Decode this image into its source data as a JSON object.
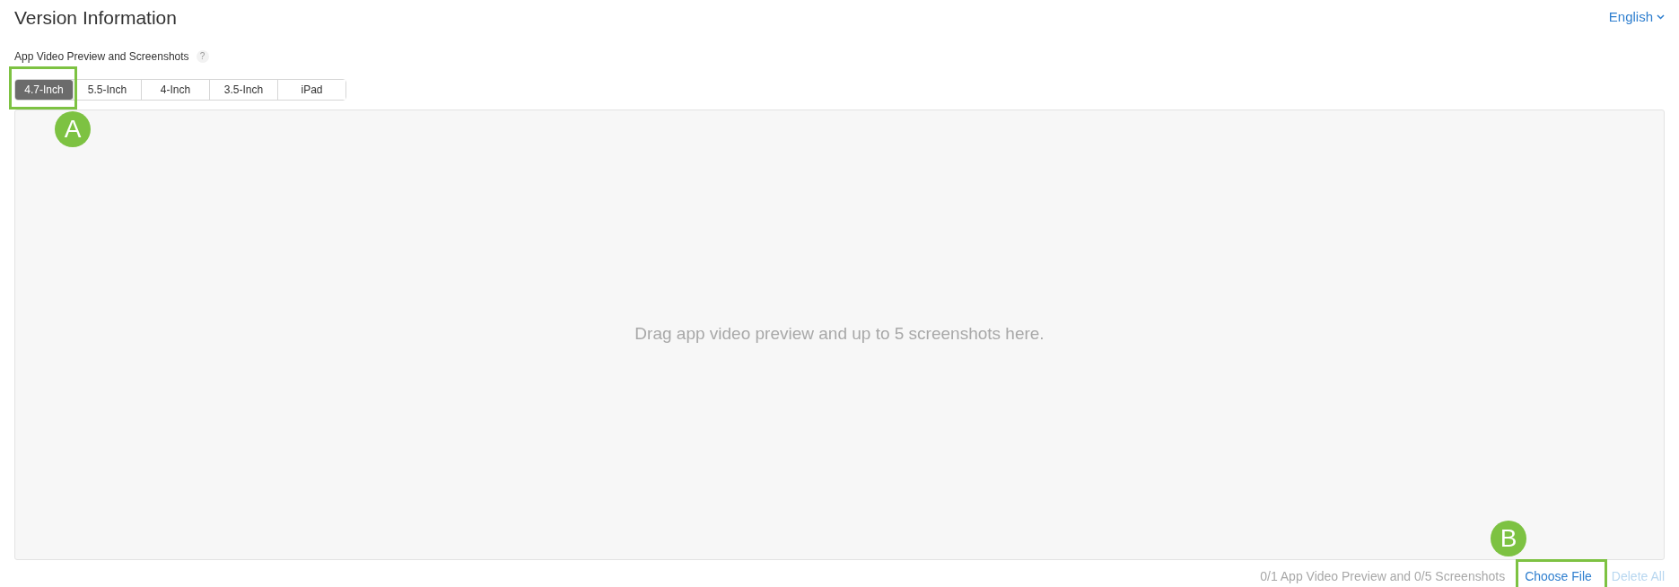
{
  "title": "Version Information",
  "language": {
    "label": "English"
  },
  "section": {
    "label": "App Video Preview and Screenshots",
    "help": "?"
  },
  "tabs": [
    {
      "label": "4.7-Inch",
      "selected": true
    },
    {
      "label": "5.5-Inch",
      "selected": false
    },
    {
      "label": "4-Inch",
      "selected": false
    },
    {
      "label": "3.5-Inch",
      "selected": false
    },
    {
      "label": "iPad",
      "selected": false
    }
  ],
  "drop_zone": {
    "message": "Drag app video preview and up to 5 screenshots here."
  },
  "footer": {
    "count": "0/1 App Video Preview and 0/5 Screenshots",
    "choose_file": "Choose File",
    "delete_all": {
      "label": "Delete All",
      "disabled": true
    }
  },
  "callouts": [
    {
      "label": "A"
    },
    {
      "label": "B"
    }
  ]
}
